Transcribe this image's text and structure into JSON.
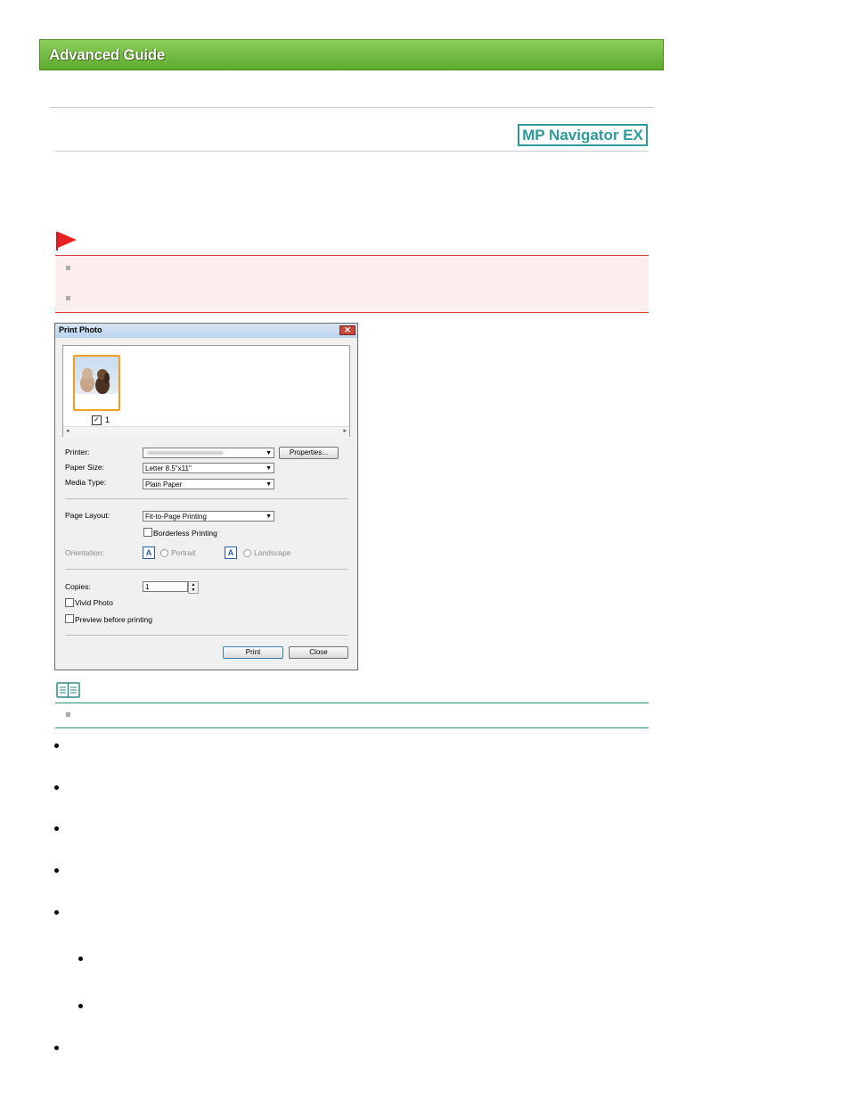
{
  "header": {
    "title": "Advanced Guide"
  },
  "badge": {
    "label": "MP Navigator EX"
  },
  "dialog": {
    "title": "Print Photo",
    "thumbnail_index": "1",
    "printer_label": "Printer:",
    "properties_label": "Properties...",
    "paper_size_label": "Paper Size:",
    "paper_size_value": "Letter 8.5\"x11\"",
    "media_type_label": "Media Type:",
    "media_type_value": "Plain Paper",
    "page_layout_label": "Page Layout:",
    "page_layout_value": "Fit-to-Page Printing",
    "borderless_label": "Borderless Printing",
    "orientation_label": "Orientation:",
    "portrait_label": "Portrait",
    "landscape_label": "Landscape",
    "copies_label": "Copies:",
    "copies_value": "1",
    "vivid_label": "Vivid Photo",
    "preview_label": "Preview before printing",
    "print_label": "Print",
    "close_label": "Close"
  },
  "colors": {
    "banner": "#6dba3c",
    "badge": "#2e9a9a",
    "important": "#d83a3a",
    "note": "#2e8a8a"
  },
  "icons": [
    "flag-icon",
    "note-icon",
    "close-icon"
  ]
}
